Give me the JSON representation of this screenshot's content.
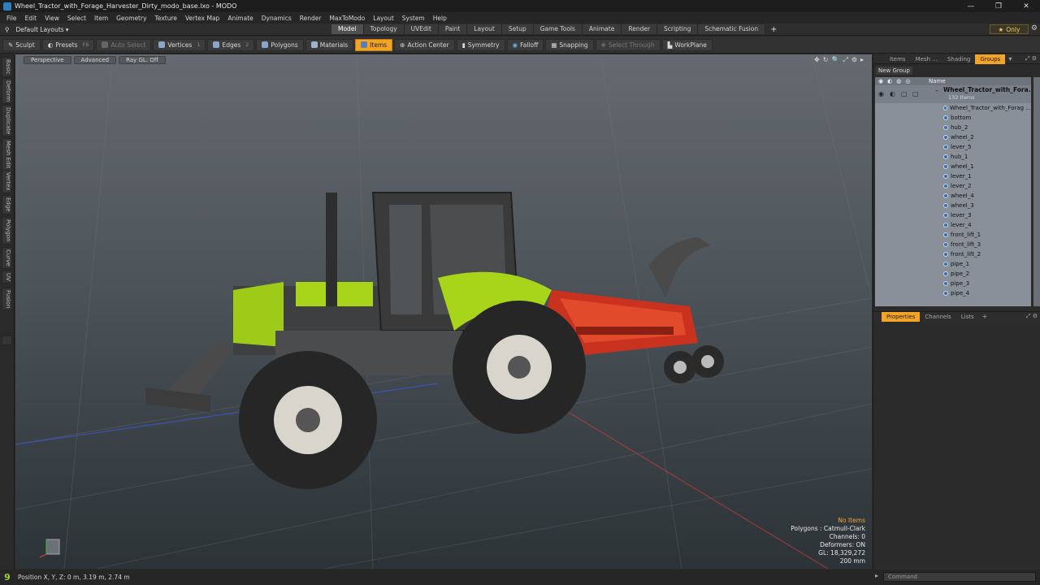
{
  "window": {
    "title": "Wheel_Tractor_with_Forage_Harvester_Dirty_modo_base.lxo - MODO",
    "minimize": "—",
    "maximize": "❐",
    "close": "✕"
  },
  "menu": [
    "File",
    "Edit",
    "View",
    "Select",
    "Item",
    "Geometry",
    "Texture",
    "Vertex Map",
    "Animate",
    "Dynamics",
    "Render",
    "MaxToModo",
    "Layout",
    "System",
    "Help"
  ],
  "layoutbar": {
    "layout_label": "Default Layouts",
    "tabs": [
      "Model",
      "Topology",
      "UVEdit",
      "Paint",
      "Layout",
      "Setup",
      "Game Tools",
      "Animate",
      "Render",
      "Scripting",
      "Schematic Fusion"
    ],
    "active_tab": "Model",
    "only_label": "Only"
  },
  "toolbar": {
    "sculpt": "Sculpt",
    "presets": "Presets",
    "presets_key": "F6",
    "auto_select": "Auto Select",
    "vertices": "Vertices",
    "vertices_key": "1",
    "edges": "Edges",
    "edges_key": "2",
    "polygons": "Polygons",
    "materials": "Materials",
    "items": "Items",
    "action_center": "Action Center",
    "symmetry": "Symmetry",
    "falloff": "Falloff",
    "snapping": "Snapping",
    "select_through": "Select Through",
    "workplane": "WorkPlane"
  },
  "left_tabs": [
    "Basic",
    "Deform",
    "Duplicate",
    "Mesh Edit",
    "Vertex",
    "Edge",
    "Polygon",
    "Curve",
    "UV",
    "Fusion"
  ],
  "viewport": {
    "view_mode": "Perspective",
    "shading": "Advanced",
    "raygl": "Ray GL: Off",
    "info": {
      "no_items": "No Items",
      "polygons": "Polygons : Catmull-Clark",
      "channels": "Channels: 0",
      "deformers": "Deformers: ON",
      "gl": "GL: 18,329,272",
      "scale": "200 mm"
    }
  },
  "right_panel": {
    "tabs": [
      "Items",
      "Mesh ...",
      "Shading",
      "Groups"
    ],
    "active_tab": "Groups",
    "new_group": "New Group",
    "column_name": "Name",
    "root_name": "Wheel_Tractor_with_Fora...",
    "root_count": "132 Items",
    "items": [
      "Wheel_Tractor_with_Forag ...",
      "bottom",
      "hub_2",
      "wheel_2",
      "lever_5",
      "hub_1",
      "wheel_1",
      "lever_1",
      "lever_2",
      "wheel_4",
      "wheel_3",
      "lever_3",
      "lever_4",
      "front_lift_1",
      "front_lift_3",
      "front_lift_2",
      "pipe_1",
      "pipe_2",
      "pipe_3",
      "pipe_4"
    ],
    "bottom_tabs": [
      "Properties",
      "Channels",
      "Lists"
    ],
    "bottom_active": "Properties"
  },
  "status": {
    "position": "Position X, Y, Z:   0 m, 3.19 m, 2.74 m",
    "command_placeholder": "Command"
  },
  "colors": {
    "accent_orange": "#f3a326",
    "tractor_green": "#a8d41a",
    "harvester_red": "#d8321e"
  }
}
